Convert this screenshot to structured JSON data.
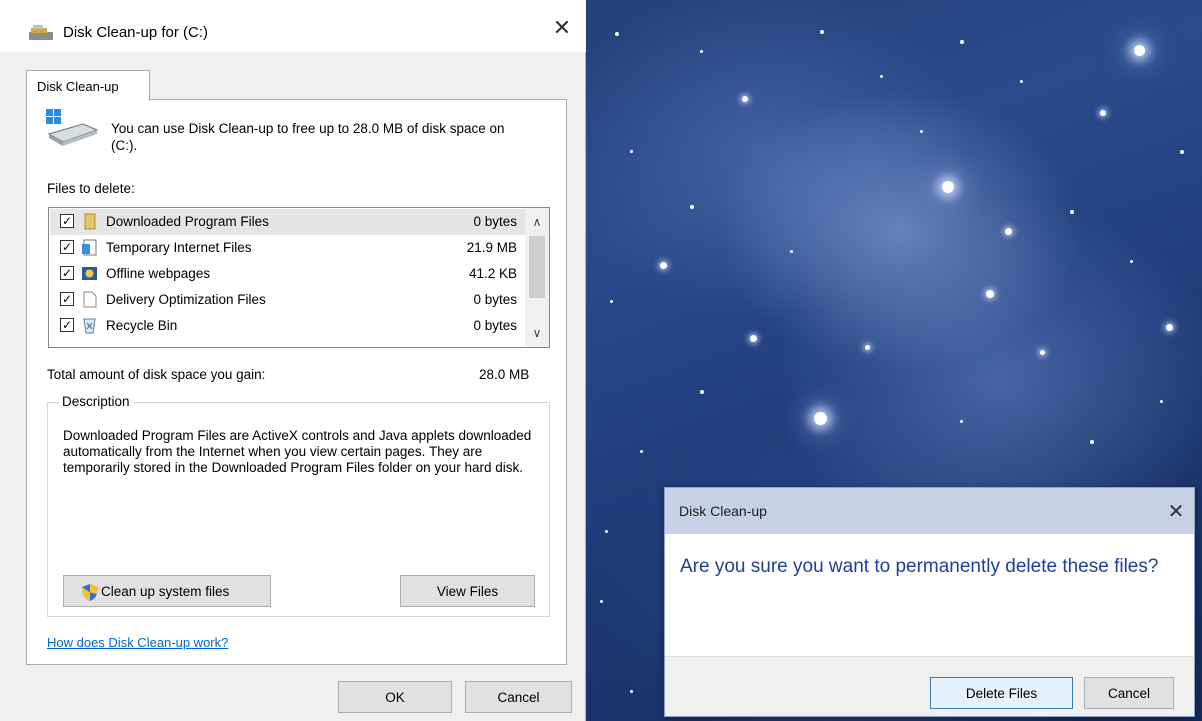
{
  "main_dialog": {
    "title": "Disk Clean-up for  (C:)",
    "tab_label": "Disk Clean-up",
    "summary": "You can use Disk Clean-up to free up to 28.0 MB of disk space on  (C:).",
    "files_label": "Files to delete:",
    "files": [
      {
        "name": "Downloaded Program Files",
        "size": "0 bytes",
        "checked": true,
        "icon": "folder-icon"
      },
      {
        "name": "Temporary Internet Files",
        "size": "21.9 MB",
        "checked": true,
        "icon": "internet-files-icon"
      },
      {
        "name": "Offline webpages",
        "size": "41.2 KB",
        "checked": true,
        "icon": "offline-webpages-icon"
      },
      {
        "name": "Delivery Optimization Files",
        "size": "0 bytes",
        "checked": true,
        "icon": "document-icon"
      },
      {
        "name": "Recycle Bin",
        "size": "0 bytes",
        "checked": true,
        "icon": "recycle-bin-icon"
      }
    ],
    "total_label": "Total amount of disk space you gain:",
    "total_value": "28.0 MB",
    "description_legend": "Description",
    "description_text": "Downloaded Program Files are ActiveX controls and Java applets downloaded automatically from the Internet when you view certain pages. They are temporarily stored in the Downloaded Program Files folder on your hard disk.",
    "cleanup_system_label": "Clean up system files",
    "view_files_label": "View Files",
    "help_link": "How does Disk Clean-up work?",
    "ok_label": "OK",
    "cancel_label": "Cancel"
  },
  "confirm_dialog": {
    "title": "Disk Clean-up",
    "question": "Are you sure you want to permanently delete these files?",
    "delete_label": "Delete Files",
    "cancel_label": "Cancel"
  },
  "colors": {
    "link": "#0066cc",
    "question_text": "#1e3f9e",
    "confirm_titlebar": "#c6d1e4",
    "primary_button_border": "#3c7fb1"
  }
}
